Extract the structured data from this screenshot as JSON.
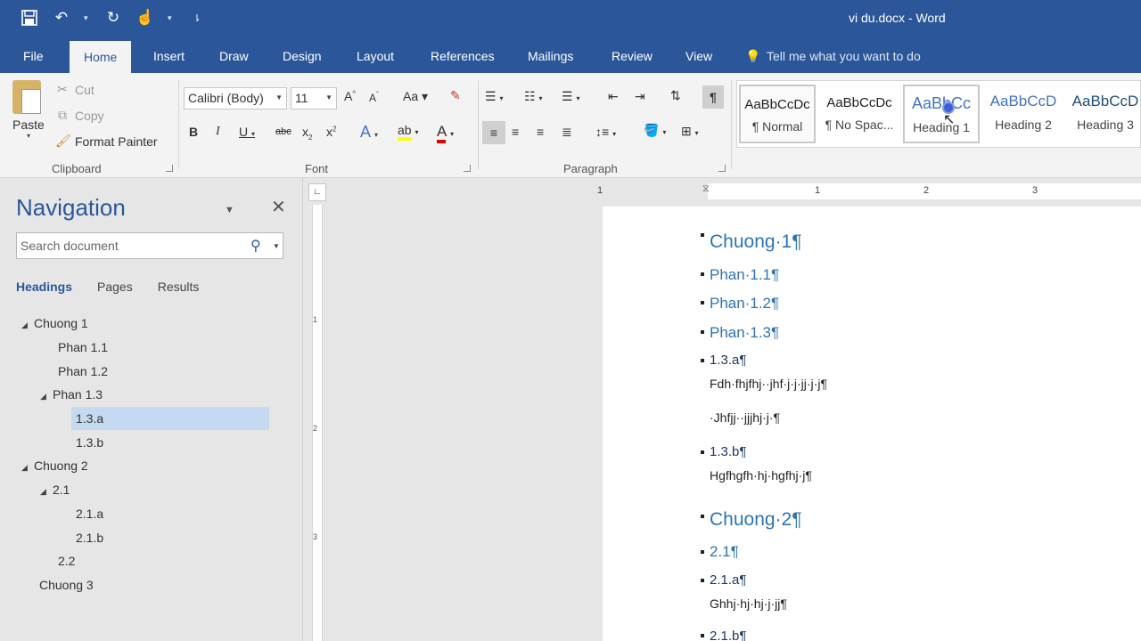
{
  "window": {
    "title": "vi du.docx  -  Word"
  },
  "qat": {
    "icons": [
      "save-icon",
      "undo-icon",
      "redo-icon",
      "touch-mode-icon",
      "customize-icon"
    ]
  },
  "tabs": [
    "File",
    "Home",
    "Insert",
    "Draw",
    "Design",
    "Layout",
    "References",
    "Mailings",
    "Review",
    "View"
  ],
  "tell_me": "Tell me what you want to do",
  "ribbon": {
    "clipboard": {
      "paste": "Paste",
      "cut": "Cut",
      "copy": "Copy",
      "format_painter": "Format Painter",
      "label": "Clipboard"
    },
    "font": {
      "name": "Calibri (Body)",
      "size": "11",
      "label": "Font"
    },
    "paragraph": {
      "label": "Paragraph"
    },
    "styles": [
      {
        "sample": "AaBbCcDc",
        "name": "¶ Normal"
      },
      {
        "sample": "AaBbCcDc",
        "name": "¶ No Spac..."
      },
      {
        "sample": "AaBbCc",
        "name": "Heading 1"
      },
      {
        "sample": "AaBbCcD",
        "name": "Heading 2"
      },
      {
        "sample": "AaBbCcD",
        "name": "Heading 3"
      }
    ]
  },
  "nav": {
    "title": "Navigation",
    "search_placeholder": "Search document",
    "tabs": [
      "Headings",
      "Pages",
      "Results"
    ],
    "headings": [
      {
        "text": "Chuong 1",
        "level": 1,
        "expanded": true
      },
      {
        "text": "Phan 1.1",
        "level": 2
      },
      {
        "text": "Phan 1.2",
        "level": 2
      },
      {
        "text": "Phan 1.3",
        "level": 2,
        "expanded": true
      },
      {
        "text": "1.3.a",
        "level": 3,
        "selected": true
      },
      {
        "text": "1.3.b",
        "level": 3
      },
      {
        "text": "Chuong 2",
        "level": 1,
        "expanded": true
      },
      {
        "text": "2.1",
        "level": 2,
        "expanded": true
      },
      {
        "text": "2.1.a",
        "level": 3
      },
      {
        "text": "2.1.b",
        "level": 3
      },
      {
        "text": "2.2",
        "level": 2
      },
      {
        "text": "Chuong 3",
        "level": 1
      }
    ]
  },
  "rulers": {
    "h_numbers": [
      "1",
      "1",
      "2",
      "3"
    ],
    "v_numbers": [
      "1",
      "2",
      "3"
    ]
  },
  "document": {
    "lines": [
      {
        "text": "Chuong·1¶",
        "style": "h1",
        "bullet": true
      },
      {
        "text": "Phan·1.1¶",
        "style": "h2",
        "bullet": true
      },
      {
        "text": "Phan·1.2¶",
        "style": "h2",
        "bullet": true
      },
      {
        "text": "Phan·1.3¶",
        "style": "h2",
        "bullet": true
      },
      {
        "text": "1.3.a¶",
        "style": "h3",
        "bullet": true
      },
      {
        "text": "Fdh·fhjfhj··jhf·j·j·jj·j·j¶",
        "style": "body",
        "bullet": false
      },
      {
        "text": "·Jhfjj··jjjhj·j·¶",
        "style": "body",
        "bullet": false
      },
      {
        "text": "1.3.b¶",
        "style": "h3",
        "bullet": true
      },
      {
        "text": "Hgfhgfh·hj·hgfhj·j¶",
        "style": "body",
        "bullet": false
      },
      {
        "text": "Chuong·2¶",
        "style": "h1",
        "bullet": true
      },
      {
        "text": "2.1¶",
        "style": "h2",
        "bullet": true
      },
      {
        "text": "2.1.a¶",
        "style": "h3",
        "bullet": true
      },
      {
        "text": "Ghhj·hj·hj·j·jj¶",
        "style": "body",
        "bullet": false
      },
      {
        "text": "2.1.b¶",
        "style": "h3",
        "bullet": true
      }
    ]
  },
  "colors": {
    "brand": "#2b579a",
    "heading": "#2e74b5",
    "selected_nav": "#c5d9f1"
  }
}
